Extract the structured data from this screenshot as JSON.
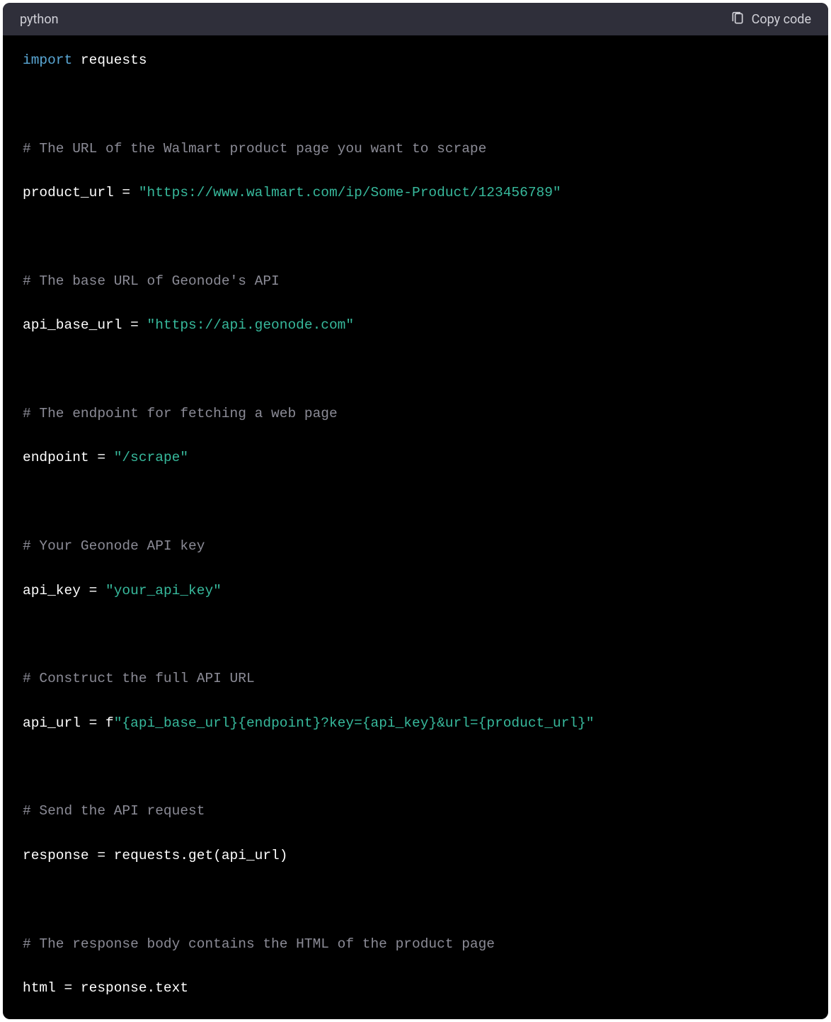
{
  "header": {
    "language": "python",
    "copy_label": "Copy code"
  },
  "code": {
    "lines": [
      {
        "tokens": [
          {
            "t": "import ",
            "c": "keyword"
          },
          {
            "t": "requests",
            "c": "name"
          }
        ]
      },
      {
        "tokens": []
      },
      {
        "tokens": [
          {
            "t": "# The URL of the Walmart product page you want to scrape",
            "c": "comment"
          }
        ]
      },
      {
        "tokens": [
          {
            "t": "product_url = ",
            "c": "name"
          },
          {
            "t": "\"https://www.walmart.com/ip/Some-Product/123456789\"",
            "c": "string"
          }
        ]
      },
      {
        "tokens": []
      },
      {
        "tokens": [
          {
            "t": "# The base URL of Geonode's API",
            "c": "comment"
          }
        ]
      },
      {
        "tokens": [
          {
            "t": "api_base_url = ",
            "c": "name"
          },
          {
            "t": "\"https://api.geonode.com\"",
            "c": "string"
          }
        ]
      },
      {
        "tokens": []
      },
      {
        "tokens": [
          {
            "t": "# The endpoint for fetching a web page",
            "c": "comment"
          }
        ]
      },
      {
        "tokens": [
          {
            "t": "endpoint = ",
            "c": "name"
          },
          {
            "t": "\"/scrape\"",
            "c": "string"
          }
        ]
      },
      {
        "tokens": []
      },
      {
        "tokens": [
          {
            "t": "# Your Geonode API key",
            "c": "comment"
          }
        ]
      },
      {
        "tokens": [
          {
            "t": "api_key = ",
            "c": "name"
          },
          {
            "t": "\"your_api_key\"",
            "c": "string"
          }
        ]
      },
      {
        "tokens": []
      },
      {
        "tokens": [
          {
            "t": "# Construct the full API URL",
            "c": "comment"
          }
        ]
      },
      {
        "tokens": [
          {
            "t": "api_url = f",
            "c": "name"
          },
          {
            "t": "\"{api_base_url}{endpoint}?key={api_key}&url={product_url}\"",
            "c": "string"
          }
        ]
      },
      {
        "tokens": []
      },
      {
        "tokens": [
          {
            "t": "# Send the API request",
            "c": "comment"
          }
        ]
      },
      {
        "tokens": [
          {
            "t": "response = requests.get(api_url)",
            "c": "name"
          }
        ]
      },
      {
        "tokens": []
      },
      {
        "tokens": [
          {
            "t": "# The response body contains the HTML of the product page",
            "c": "comment"
          }
        ]
      },
      {
        "tokens": [
          {
            "t": "html = response.text",
            "c": "name"
          }
        ]
      }
    ]
  }
}
